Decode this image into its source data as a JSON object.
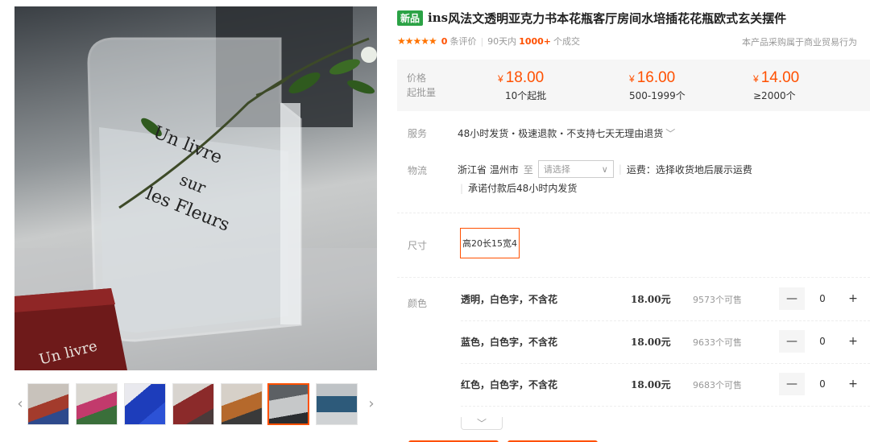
{
  "gallery": {
    "main_text": [
      "Un livre",
      "sur",
      "les Fleurs"
    ],
    "thumbnails": [
      {
        "label": "thumbnail-1",
        "colors": [
          "#c8c2bb",
          "#a33b2c",
          "#2e4a8c"
        ]
      },
      {
        "label": "thumbnail-2",
        "colors": [
          "#d9d6d0",
          "#c23a6c",
          "#3a6f3a"
        ]
      },
      {
        "label": "thumbnail-3",
        "colors": [
          "#e9e9ee",
          "#1d3dbb",
          "#2c52d6"
        ]
      },
      {
        "label": "thumbnail-4",
        "colors": [
          "#d8d4cf",
          "#8b2a2a",
          "#4a3a3a"
        ]
      },
      {
        "label": "thumbnail-5",
        "colors": [
          "#d6d0c8",
          "#b5692c",
          "#3a3a3a"
        ]
      },
      {
        "label": "thumbnail-6",
        "colors": [
          "#5c6064",
          "#c6c8c9",
          "#2a2d30"
        ]
      },
      {
        "label": "thumbnail-7",
        "colors": [
          "#bfc3c6",
          "#2d5a7a",
          "#cfd2d4"
        ]
      }
    ],
    "prev_arrow": "‹",
    "next_arrow": "›"
  },
  "product": {
    "badge": "新品",
    "title_prefix": "ins",
    "title": "风法文透明亚克力书本花瓶客厅房间水培插花花瓶欧式玄关摆件",
    "stars": "★★★★★",
    "review_count": "0",
    "review_label": "条评价",
    "sales_prefix": "90天内",
    "sales_count": "1000+",
    "sales_suffix": "个成交",
    "purchase_note": "本产品采购属于商业贸易行为"
  },
  "price": {
    "label_price": "价格",
    "label_moq": "起批量",
    "currency": "¥",
    "tiers": [
      {
        "amount": "18.00",
        "qty": "10个起批"
      },
      {
        "amount": "16.00",
        "qty": "500-1999个"
      },
      {
        "amount": "14.00",
        "qty": "≥2000个"
      }
    ]
  },
  "service": {
    "label": "服务",
    "text": "48小时发货・极速退款・不支持七天无理由退货",
    "arrow": "﹀"
  },
  "logistics": {
    "label": "物流",
    "origin": "浙江省 温州市",
    "to": "至",
    "select_placeholder": "请选择",
    "select_arrow": "∨",
    "shipping": "运费：选择收货地后展示运费",
    "promise": "承诺付款后48小时内发货"
  },
  "size": {
    "label": "尺寸",
    "option": "高20长15宽4"
  },
  "color": {
    "label": "颜色",
    "skus": [
      {
        "name": "透明，白色字，不含花",
        "price": "18.00元",
        "stock": "9573个可售",
        "qty": "0"
      },
      {
        "name": "蓝色，白色字，不含花",
        "price": "18.00元",
        "stock": "9633个可售",
        "qty": "0"
      },
      {
        "name": "红色，白色字，不含花",
        "price": "18.00元",
        "stock": "9683个可售",
        "qty": "0"
      }
    ],
    "minus": "—",
    "plus": "+",
    "expand": "﹀"
  }
}
